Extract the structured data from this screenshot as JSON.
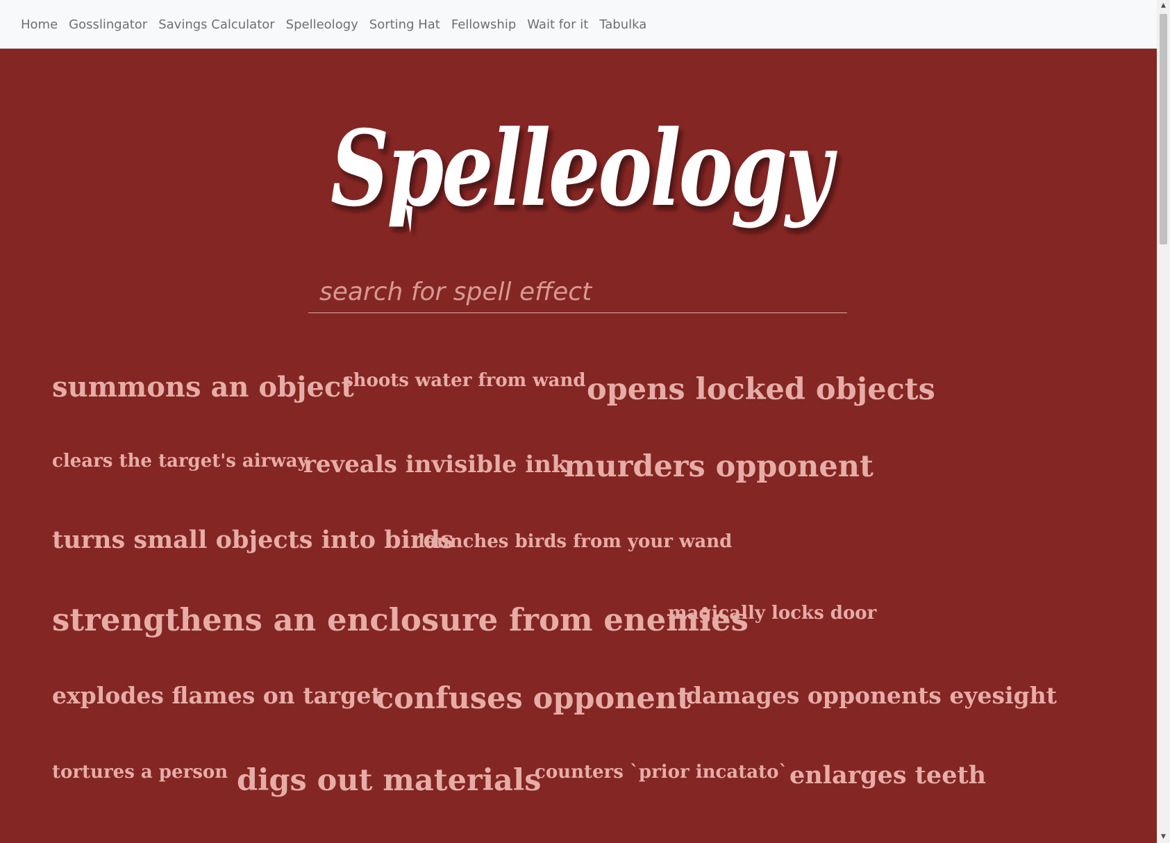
{
  "nav": {
    "items": [
      "Home",
      "Gosslingator",
      "Savings Calculator",
      "Spelleology",
      "Sorting Hat",
      "Fellowship",
      "Wait for it",
      "Tabulka"
    ]
  },
  "logo": {
    "text": "Spelleology"
  },
  "search": {
    "placeholder": "search for spell effect",
    "value": ""
  },
  "spells": [
    "summons an object",
    "shoots water from wand",
    "opens locked objects",
    "clears the target's airway",
    "reveals invisible ink",
    "murders opponent",
    "turns small objects into birds",
    "launches birds from your wand",
    "strengthens an enclosure from enemies",
    "magically locks door",
    "explodes flames on target",
    "confuses opponent",
    "damages opponents eyesight",
    "tortures a person",
    "digs out materials",
    "counters `prior incatato`",
    "enlarges teeth"
  ],
  "colors": {
    "background": "#842624",
    "navbar": "#f8f9fa",
    "spell_text": "#e6ada7",
    "logo": "#ffffff"
  },
  "icons": {
    "scroll_up": "triangle-up-icon",
    "scroll_down": "triangle-down-icon"
  }
}
